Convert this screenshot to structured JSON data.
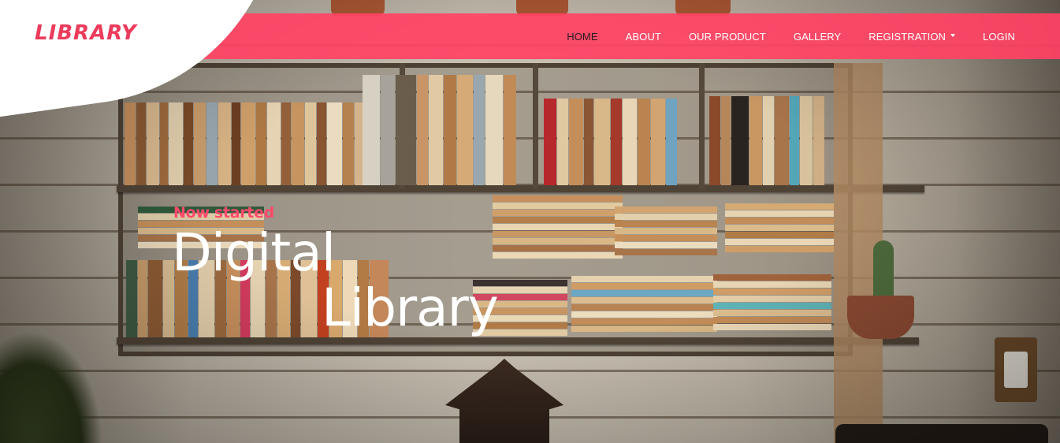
{
  "brand": {
    "logo_text": "LIBRARY",
    "accent_color": "#ff4264"
  },
  "nav": {
    "items": [
      {
        "label": "HOME",
        "active": true
      },
      {
        "label": "ABOUT"
      },
      {
        "label": "OUR PRODUCT"
      },
      {
        "label": "GALLERY"
      },
      {
        "label": "REGISTRATION",
        "dropdown": true
      },
      {
        "label": "LOGIN"
      }
    ]
  },
  "hero": {
    "eyebrow": "Now started",
    "title_line1": "Digital",
    "title_line2": "Library"
  }
}
